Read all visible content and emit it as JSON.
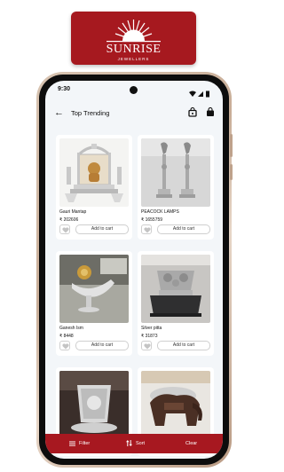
{
  "brand": {
    "name": "SUNRISE",
    "tagline": "JEWELLERS"
  },
  "status_bar": {
    "time": "9:30"
  },
  "header": {
    "title": "Top Trending",
    "back_icon": "arrow-left-icon",
    "action_icons": [
      "shopping-bag-icon",
      "cart-bag-icon"
    ]
  },
  "products": [
    {
      "name": "Gauri Mantap",
      "price": "₹ 202606",
      "add_label": "Add to cart"
    },
    {
      "name": "PEACOCK LAMPS",
      "price": "₹ 1655759",
      "add_label": "Add to cart"
    },
    {
      "name": "Ganesh Ism",
      "price": "₹ 8448",
      "add_label": "Add to cart"
    },
    {
      "name": "Silver pitta",
      "price": "₹ 31873",
      "add_label": "Add to cart"
    },
    {
      "name": "",
      "price": "",
      "add_label": ""
    },
    {
      "name": "",
      "price": "",
      "add_label": ""
    }
  ],
  "bottom_bar": {
    "filter_label": "Filter",
    "sort_label": "Sort",
    "clear_label": "Clear"
  },
  "colors": {
    "brand_red": "#a6191f",
    "screen_bg": "#f3f6f9"
  }
}
